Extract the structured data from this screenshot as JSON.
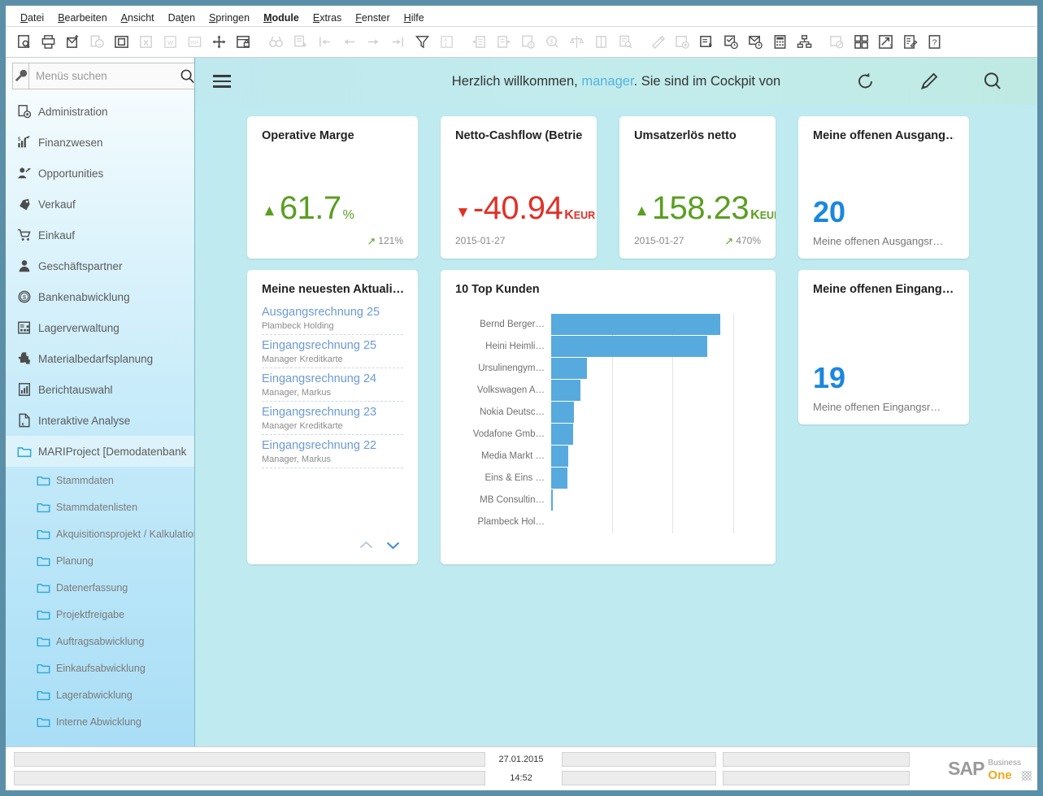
{
  "window": {
    "minimize_label": "–",
    "maximize_label": "❐",
    "close_label": "✕"
  },
  "menubar": [
    {
      "label": "Datei",
      "bold": false
    },
    {
      "label": "Bearbeiten",
      "bold": false
    },
    {
      "label": "Ansicht",
      "bold": false
    },
    {
      "label": "Daten",
      "bold": false
    },
    {
      "label": "Springen",
      "bold": false
    },
    {
      "label": "Module",
      "bold": true
    },
    {
      "label": "Extras",
      "bold": false
    },
    {
      "label": "Fenster",
      "bold": false
    },
    {
      "label": "Hilfe",
      "bold": false
    }
  ],
  "toolbar": {
    "icons": [
      {
        "name": "preview-icon",
        "enabled": true
      },
      {
        "name": "print-icon",
        "enabled": true
      },
      {
        "name": "send-email-icon",
        "enabled": true
      },
      {
        "name": "send-sms-icon",
        "enabled": false
      },
      {
        "name": "layout-designer-icon",
        "enabled": true
      },
      {
        "name": "export-excel-icon",
        "enabled": false
      },
      {
        "name": "export-word-icon",
        "enabled": false
      },
      {
        "name": "export-pdf-icon",
        "enabled": false
      },
      {
        "name": "move-icon",
        "enabled": true
      },
      {
        "name": "lock-layout-icon",
        "enabled": true
      },
      {
        "name": "find-icon",
        "enabled": false
      },
      {
        "name": "add-record-icon",
        "enabled": false
      },
      {
        "name": "first-record-icon",
        "enabled": false
      },
      {
        "name": "previous-record-icon",
        "enabled": false
      },
      {
        "name": "next-record-icon",
        "enabled": false
      },
      {
        "name": "last-record-icon",
        "enabled": false
      },
      {
        "name": "filter-icon",
        "enabled": true
      },
      {
        "name": "sort-icon",
        "enabled": false
      },
      {
        "name": "previous-document-icon",
        "enabled": false
      },
      {
        "name": "next-document-icon",
        "enabled": false
      },
      {
        "name": "journal-entry-icon",
        "enabled": false
      },
      {
        "name": "payment-means-icon",
        "enabled": false
      },
      {
        "name": "gross-profit-icon",
        "enabled": false
      },
      {
        "name": "volume-weight-icon",
        "enabled": false
      },
      {
        "name": "related-documents-icon",
        "enabled": false
      },
      {
        "name": "document-lookup-icon",
        "enabled": false
      },
      {
        "name": "user-defined-fields-icon",
        "enabled": false
      },
      {
        "name": "settings-form-icon",
        "enabled": false
      },
      {
        "name": "workflow-icon",
        "enabled": true
      },
      {
        "name": "activity-icon",
        "enabled": true
      },
      {
        "name": "messages-icon",
        "enabled": true
      },
      {
        "name": "calculator-icon",
        "enabled": true
      },
      {
        "name": "organization-chart-icon",
        "enabled": true
      },
      {
        "name": "drag-relate-icon",
        "enabled": false
      },
      {
        "name": "cockpit-icon",
        "enabled": true
      },
      {
        "name": "script-icon",
        "enabled": true
      },
      {
        "name": "notes-icon",
        "enabled": true
      },
      {
        "name": "help-icon",
        "enabled": true
      }
    ]
  },
  "sidebar": {
    "tools_icon": "wrench-icon",
    "search": {
      "placeholder": "Menüs suchen",
      "value": "",
      "icon": "search-icon"
    },
    "items": [
      {
        "label": "Administration",
        "icon": "administration-icon",
        "level": 0,
        "active": false
      },
      {
        "label": "Finanzwesen",
        "icon": "finance-icon",
        "level": 0,
        "active": false
      },
      {
        "label": "Opportunities",
        "icon": "opportunities-icon",
        "level": 0,
        "active": false
      },
      {
        "label": "Verkauf",
        "icon": "sales-icon",
        "level": 0,
        "active": false
      },
      {
        "label": "Einkauf",
        "icon": "purchasing-icon",
        "level": 0,
        "active": false
      },
      {
        "label": "Geschäftspartner",
        "icon": "business-partner-icon",
        "level": 0,
        "active": false
      },
      {
        "label": "Bankenabwicklung",
        "icon": "banking-icon",
        "level": 0,
        "active": false
      },
      {
        "label": "Lagerverwaltung",
        "icon": "inventory-icon",
        "level": 0,
        "active": false
      },
      {
        "label": "Materialbedarfsplanung",
        "icon": "mrp-icon",
        "level": 0,
        "active": false
      },
      {
        "label": "Berichtauswahl",
        "icon": "reports-icon",
        "level": 0,
        "active": false
      },
      {
        "label": "Interaktive Analyse",
        "icon": "interactive-analysis-icon",
        "level": 0,
        "active": false
      },
      {
        "label": "MARIProject [Demodatenbank",
        "icon": "folder-icon",
        "level": 0,
        "active": true
      },
      {
        "label": "Stammdaten",
        "icon": "folder-icon",
        "level": 1,
        "active": false
      },
      {
        "label": "Stammdatenlisten",
        "icon": "folder-icon",
        "level": 1,
        "active": false
      },
      {
        "label": "Akquisitionsprojekt / Kalkulation",
        "icon": "folder-icon",
        "level": 1,
        "active": false
      },
      {
        "label": "Planung",
        "icon": "folder-icon",
        "level": 1,
        "active": false
      },
      {
        "label": "Datenerfassung",
        "icon": "folder-icon",
        "level": 1,
        "active": false
      },
      {
        "label": "Projektfreigabe",
        "icon": "folder-icon",
        "level": 1,
        "active": false
      },
      {
        "label": "Auftragsabwicklung",
        "icon": "folder-icon",
        "level": 1,
        "active": false
      },
      {
        "label": "Einkaufsabwicklung",
        "icon": "folder-icon",
        "level": 1,
        "active": false
      },
      {
        "label": "Lagerabwicklung",
        "icon": "folder-icon",
        "level": 1,
        "active": false
      },
      {
        "label": "Interne Abwicklung",
        "icon": "folder-icon",
        "level": 1,
        "active": false
      }
    ]
  },
  "cockpit": {
    "menu_icon": "hamburger-icon",
    "welcome_prefix": "Herzlich willkommen, ",
    "welcome_user": "manager",
    "welcome_suffix": ". Sie sind im Cockpit von",
    "actions": [
      {
        "name": "refresh-icon",
        "label": "Aktualisieren"
      },
      {
        "name": "edit-icon",
        "label": "Bearbeiten"
      },
      {
        "name": "search-icon",
        "label": "Suchen"
      }
    ]
  },
  "widgets": {
    "operative_marge": {
      "title": "Operative Marge",
      "trend": "up",
      "value": "61.7",
      "unit": "%",
      "delta": "121%",
      "date": ""
    },
    "netto_cashflow": {
      "title": "Netto-Cashflow (Betrieb)",
      "trend": "down",
      "value": "-40.94",
      "unit_k": "K",
      "unit_cur": "EUR",
      "date": "2015-01-27",
      "delta": ""
    },
    "umsatzerloes": {
      "title": "Umsatzerlös netto",
      "trend": "up",
      "value": "158.23",
      "unit_k": "K",
      "unit_cur": "EUR",
      "date": "2015-01-27",
      "delta": "470%"
    },
    "offene_ausgang": {
      "title": "Meine offenen Ausgang…",
      "count": "20",
      "subtitle": "Meine offenen Ausgangsr…"
    },
    "offene_eingang": {
      "title": "Meine offenen Eingang…",
      "count": "19",
      "subtitle": "Meine offenen Eingangsr…"
    },
    "news": {
      "title": "Meine neuesten Aktuali…",
      "items": [
        {
          "link": "Ausgangsrechnung 25",
          "sub": "Plambeck Holding"
        },
        {
          "link": "Eingangsrechnung 25",
          "sub": "Manager Kreditkarte"
        },
        {
          "link": "Eingangsrechnung 24",
          "sub": "Manager, Markus"
        },
        {
          "link": "Eingangsrechnung 23",
          "sub": "Manager Kreditkarte"
        },
        {
          "link": "Eingangsrechnung 22",
          "sub": "Manager, Markus"
        }
      ],
      "nav_up": "▲",
      "nav_down": "▼"
    }
  },
  "chart_data": {
    "type": "bar",
    "title": "10 Top Kunden",
    "orientation": "horizontal",
    "categories": [
      "Bernd Berger…",
      "Heini Heimli…",
      "Ursulinengym…",
      "Volkswagen A…",
      "Nokia Deutsc…",
      "Vodafone Gmb…",
      "Media Markt …",
      "Eins & Eins …",
      "MB Consultin…",
      "Plambeck Hol…"
    ],
    "values": [
      92.8,
      85.4,
      19.5,
      16.2,
      12.4,
      11.9,
      9.3,
      9.0,
      0.8,
      0
    ],
    "xlabel": "",
    "ylabel": "",
    "xlim": [
      0,
      115
    ],
    "gridlines": [
      33.3,
      66.6,
      100
    ],
    "grid": true,
    "legend": false,
    "bar_color": "#56aade"
  },
  "statusbar": {
    "date": "27.01.2015",
    "time": "14:52",
    "fields": [
      "",
      "",
      "",
      "",
      "",
      ""
    ],
    "logo": {
      "sap": "SAP",
      "business": "Business",
      "one": "One"
    }
  }
}
